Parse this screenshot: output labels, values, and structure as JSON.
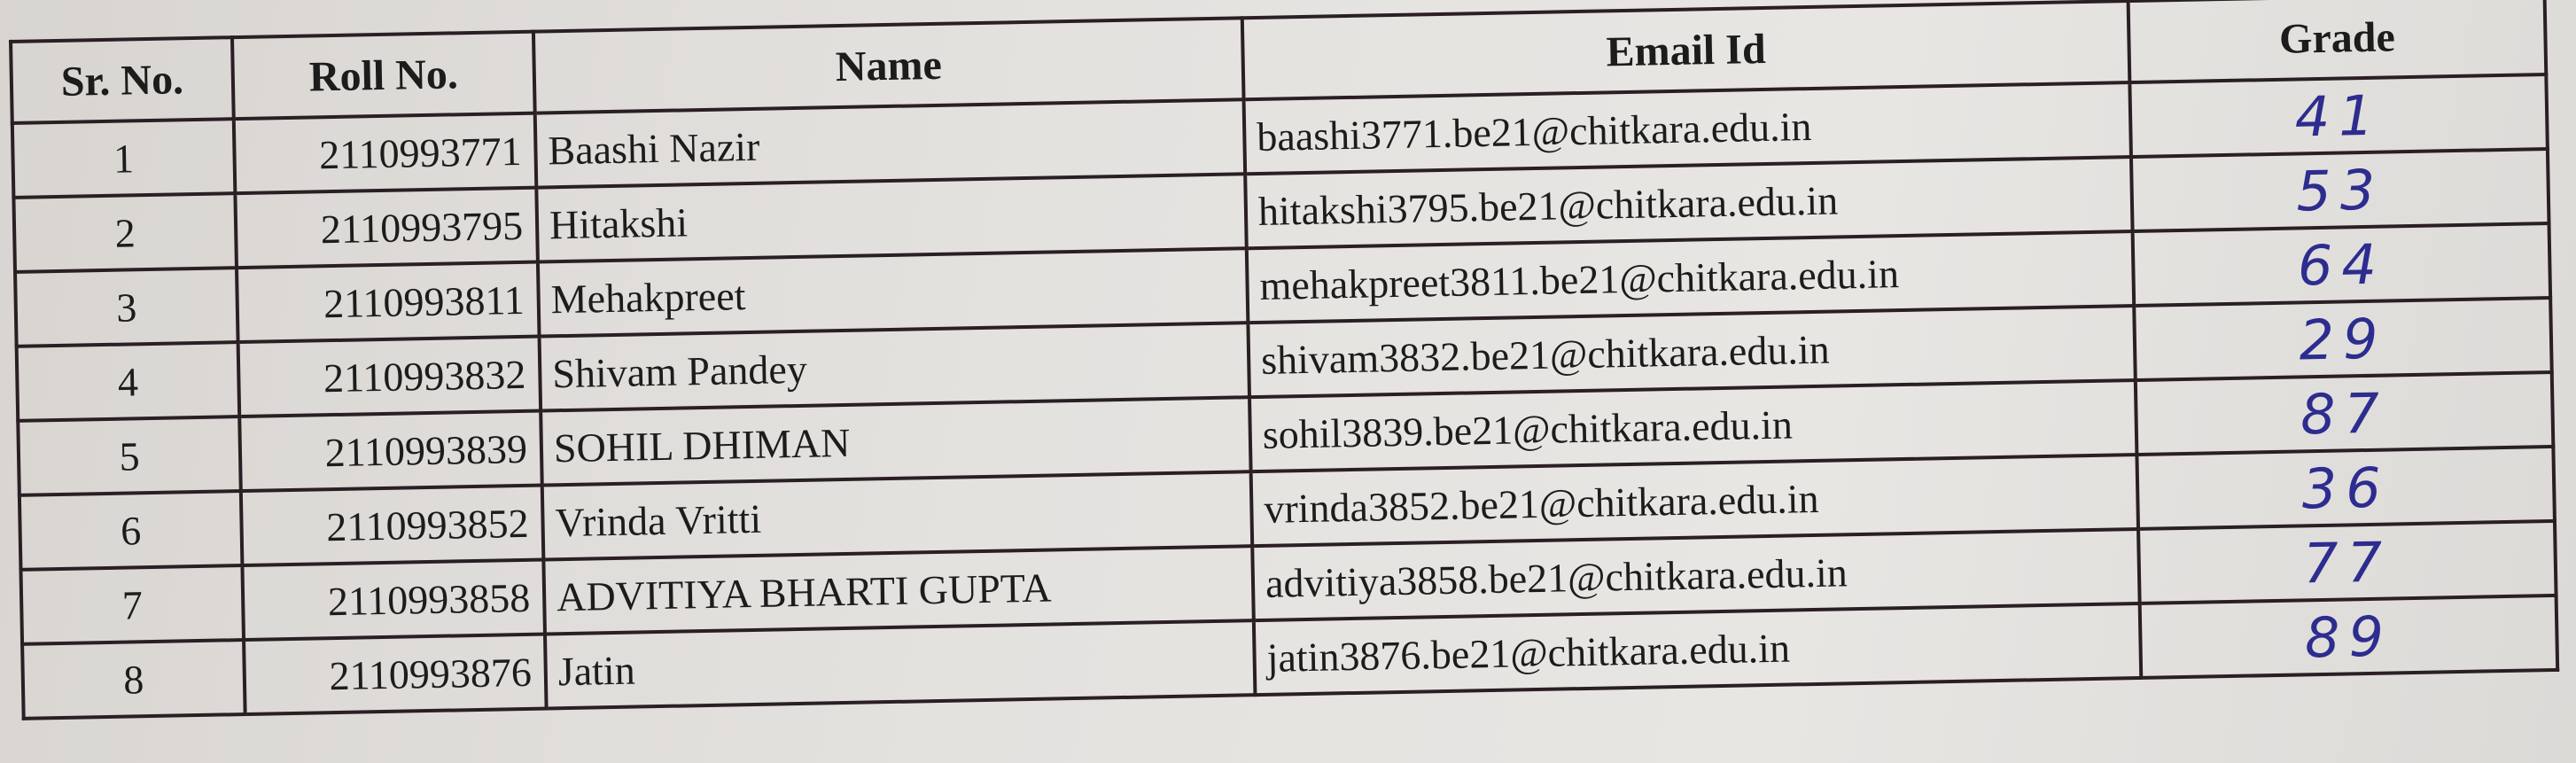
{
  "table": {
    "headers": [
      "Sr. No.",
      "Roll No.",
      "Name",
      "Email Id",
      "Grade"
    ],
    "rows": [
      {
        "sr": "1",
        "roll": "2110993771",
        "name": "Baashi Nazir",
        "email": "baashi3771.be21@chitkara.edu.in",
        "grade": "41"
      },
      {
        "sr": "2",
        "roll": "2110993795",
        "name": "Hitakshi",
        "email": "hitakshi3795.be21@chitkara.edu.in",
        "grade": "53"
      },
      {
        "sr": "3",
        "roll": "2110993811",
        "name": "Mehakpreet",
        "email": "mehakpreet3811.be21@chitkara.edu.in",
        "grade": "64"
      },
      {
        "sr": "4",
        "roll": "2110993832",
        "name": "Shivam Pandey",
        "email": "shivam3832.be21@chitkara.edu.in",
        "grade": "29"
      },
      {
        "sr": "5",
        "roll": "2110993839",
        "name": "SOHIL DHIMAN",
        "email": "sohil3839.be21@chitkara.edu.in",
        "grade": "87"
      },
      {
        "sr": "6",
        "roll": "2110993852",
        "name": "Vrinda Vritti",
        "email": "vrinda3852.be21@chitkara.edu.in",
        "grade": "36"
      },
      {
        "sr": "7",
        "roll": "2110993858",
        "name": "ADVITIYA BHARTI GUPTA",
        "email": "advitiya3858.be21@chitkara.edu.in",
        "grade": "77"
      },
      {
        "sr": "8",
        "roll": "2110993876",
        "name": "Jatin",
        "email": "jatin3876.be21@chitkara.edu.in",
        "grade": "89"
      }
    ]
  }
}
